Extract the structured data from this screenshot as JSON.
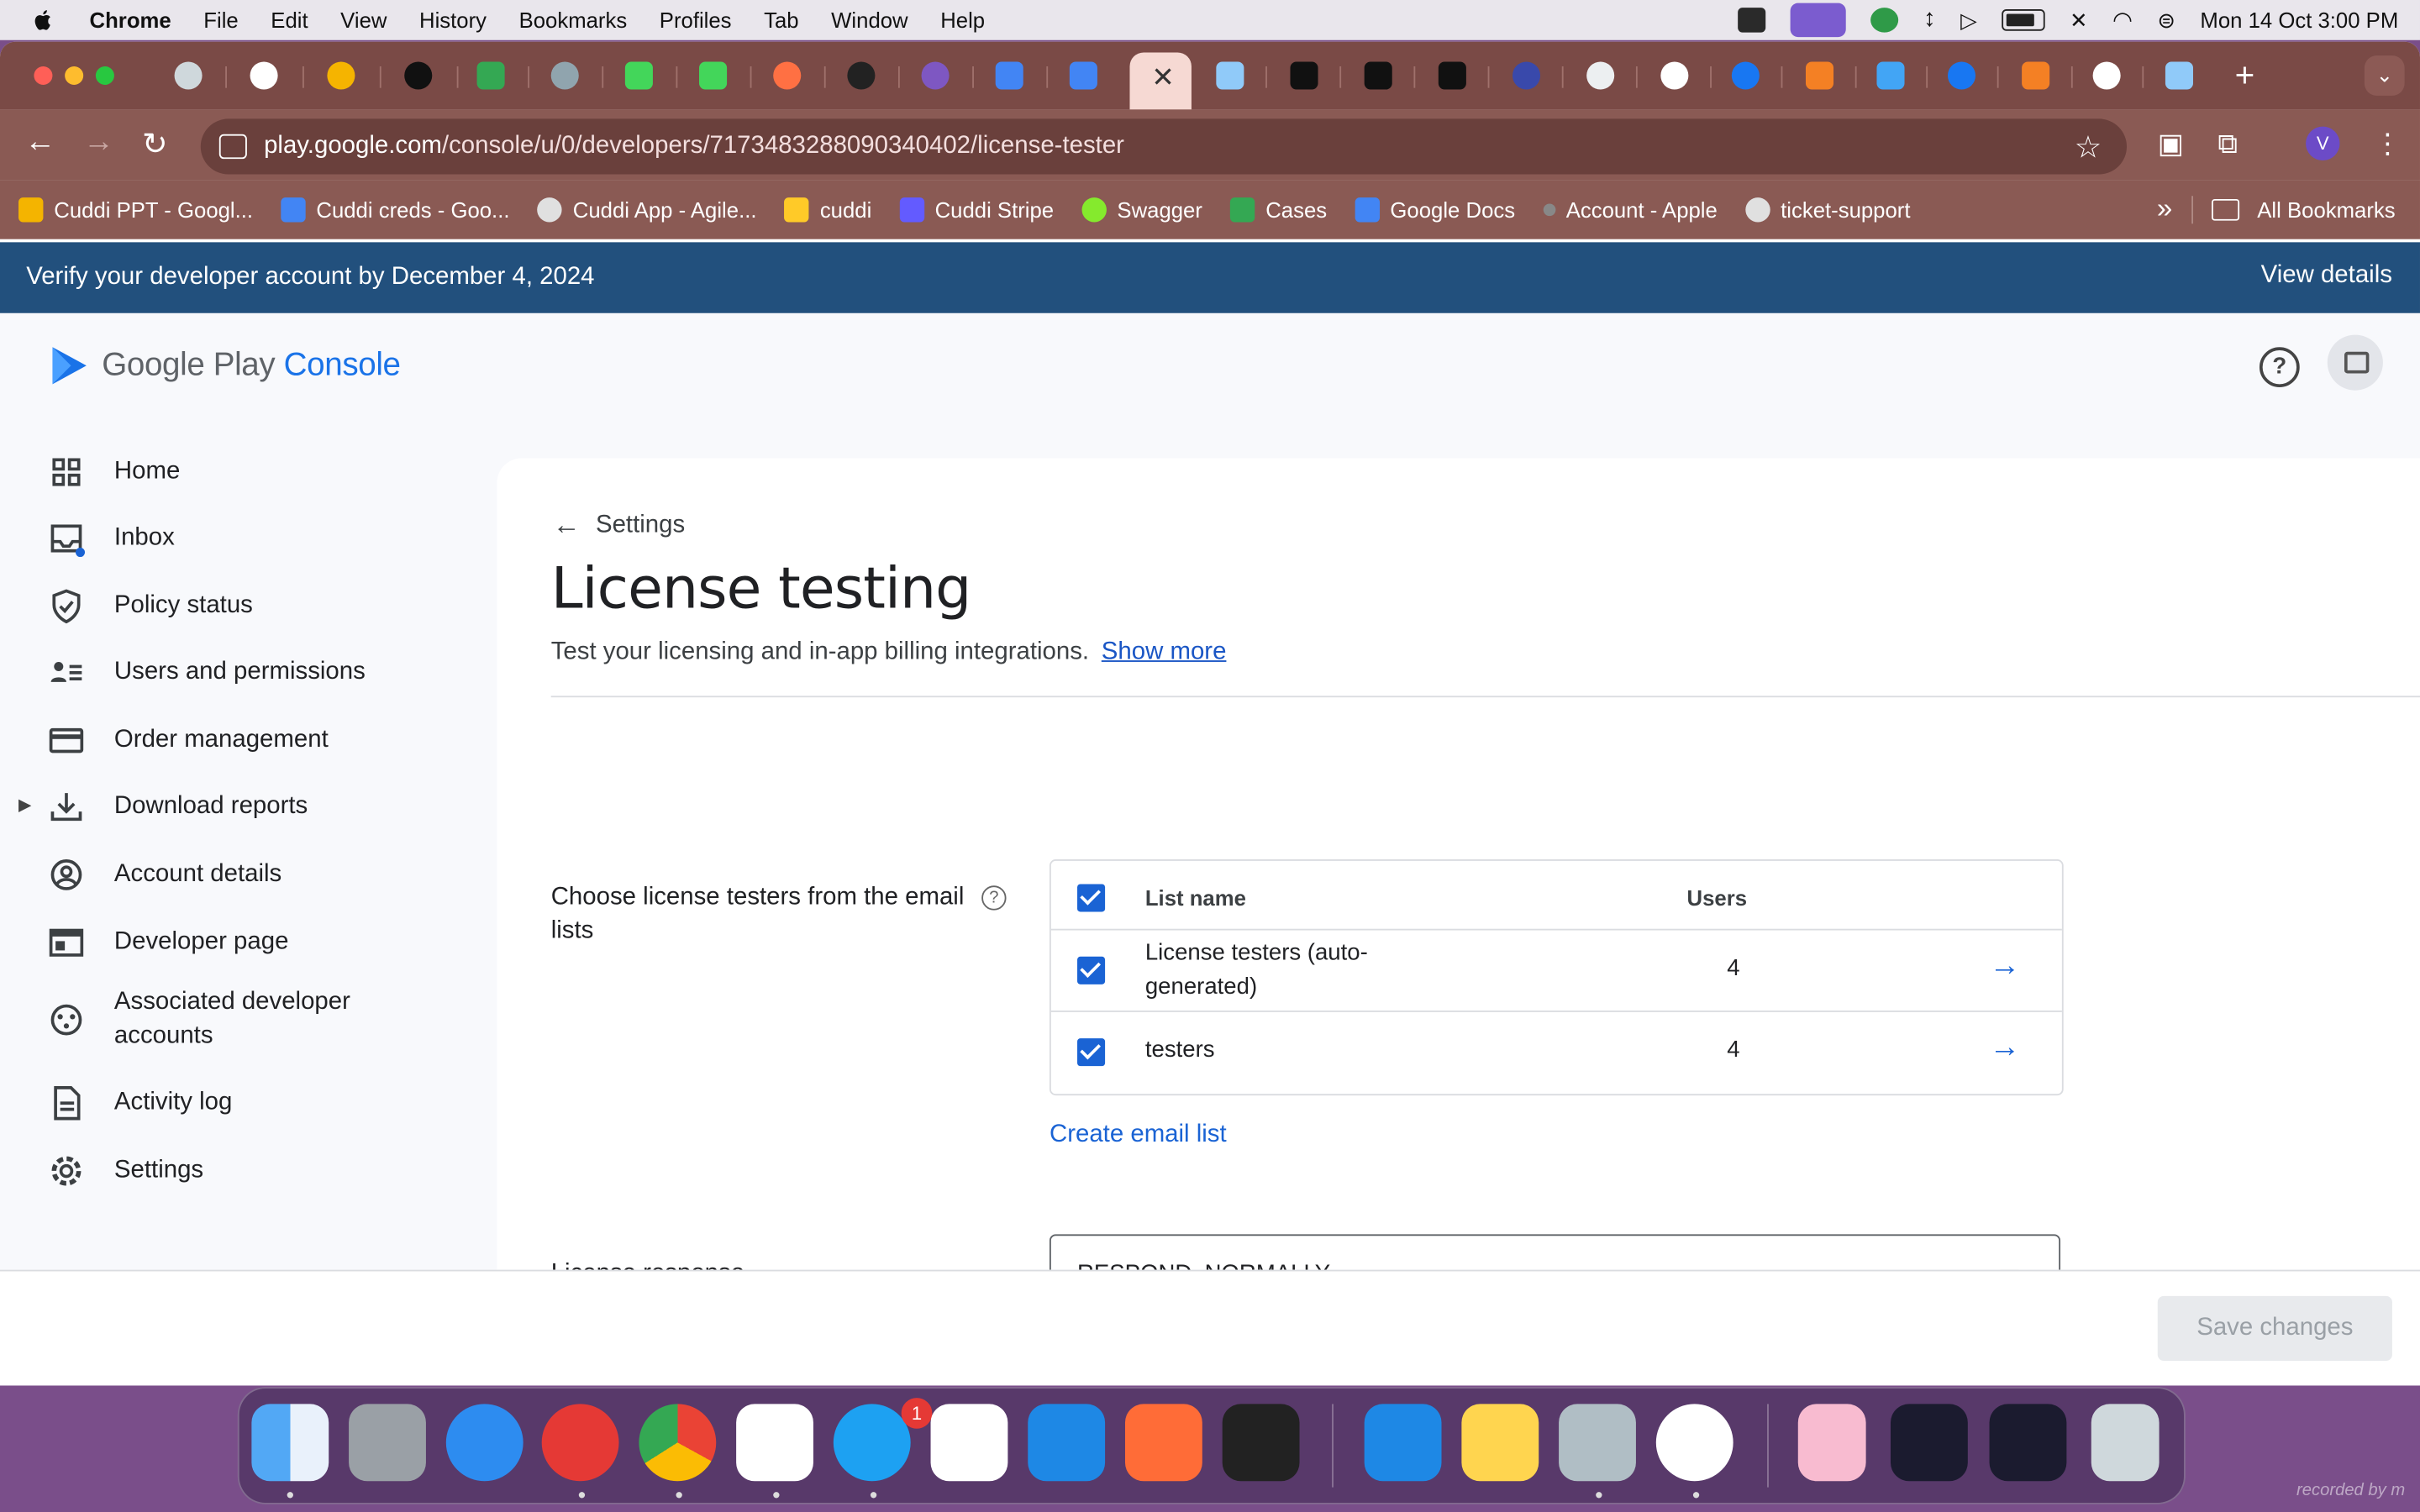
{
  "menubar": {
    "app_name": "Chrome",
    "menus": [
      "File",
      "Edit",
      "View",
      "History",
      "Bookmarks",
      "Profiles",
      "Tab",
      "Window",
      "Help"
    ],
    "clock": "Mon 14 Oct  3:00 PM"
  },
  "browser": {
    "active_tab_close": "✕",
    "url_domain": "play.google.com",
    "url_path": "/console/u/0/developers/7173483288090340402/license-tester",
    "profile_initial": "V",
    "bookmarks": [
      {
        "label": "Cuddi PPT - Googl...",
        "color": "#f4b400"
      },
      {
        "label": "Cuddi creds - Goo...",
        "color": "#4285f4"
      },
      {
        "label": "Cuddi App - Agile...",
        "color": "#e0e0e0"
      },
      {
        "label": "cuddi",
        "color": "#ffca28"
      },
      {
        "label": "Cuddi Stripe",
        "color": "#635bff"
      },
      {
        "label": "Swagger",
        "color": "#85ea2d"
      },
      {
        "label": "Cases",
        "color": "#34a853"
      },
      {
        "label": "Google Docs",
        "color": "#4285f4"
      },
      {
        "label": "Account - Apple",
        "color": "#888888"
      },
      {
        "label": "ticket-support",
        "color": "#e0e0e0"
      }
    ],
    "all_bookmarks": "All Bookmarks",
    "overflow": "»"
  },
  "banner": {
    "message": "Verify your developer account by December 4, 2024",
    "link": "View details"
  },
  "console": {
    "logo_google": "Google Play",
    "logo_console": "Console",
    "help": "?",
    "nav": [
      {
        "label": "Home",
        "icon": "home-grid-icon"
      },
      {
        "label": "Inbox",
        "icon": "inbox-icon"
      },
      {
        "label": "Policy status",
        "icon": "shield-icon"
      },
      {
        "label": "Users and permissions",
        "icon": "users-icon"
      },
      {
        "label": "Order management",
        "icon": "credit-card-icon"
      },
      {
        "label": "Download reports",
        "icon": "download-icon"
      },
      {
        "label": "Account details",
        "icon": "account-circle-icon"
      },
      {
        "label": "Developer page",
        "icon": "developer-page-icon"
      },
      {
        "label": "Associated developer accounts",
        "icon": "associated-accounts-icon"
      },
      {
        "label": "Activity log",
        "icon": "document-icon"
      },
      {
        "label": "Settings",
        "icon": "gear-icon"
      }
    ],
    "back_label": "Settings",
    "title": "License testing",
    "subtitle": "Test your licensing and in-app billing integrations.",
    "show_more": "Show more",
    "testers_label": "Choose license testers from the email lists",
    "table": {
      "col_list": "List name",
      "col_users": "Users",
      "rows": [
        {
          "name": "License testers (auto-generated)",
          "users": "4"
        },
        {
          "name": "testers",
          "users": "4"
        }
      ]
    },
    "create_list": "Create email list",
    "license_response_label": "License response",
    "license_response_value": "RESPOND_NORMALLY",
    "save_changes": "Save changes"
  },
  "dock": {
    "skype_badge": "1",
    "recorded": "recorded by m"
  },
  "colors": {
    "accent": "#1a73e8",
    "banner": "#22507d",
    "tabbar": "#7a4a46"
  }
}
